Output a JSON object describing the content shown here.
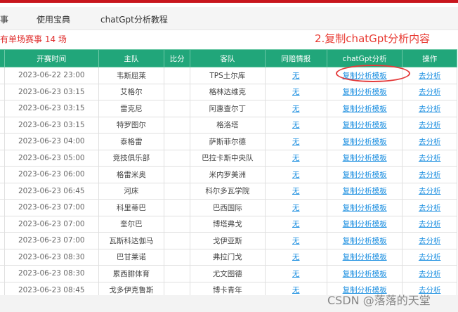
{
  "nav": {
    "items": [
      "事",
      "使用宝典",
      "chatGpt分析教程"
    ]
  },
  "summary": "有单场赛事 14 场",
  "annotation": "2.复制chatGpt分析内容",
  "table": {
    "headers": [
      "",
      "开赛时间",
      "主队",
      "比分",
      "客队",
      "同赔情报",
      "chatGpt分析",
      "操作"
    ],
    "rows": [
      [
        "2023-06-22 23:00",
        "韦斯屈莱",
        "",
        "TPS土尔库",
        "无",
        "复制分析模板",
        "去分析"
      ],
      [
        "2023-06-23 03:15",
        "艾格尔",
        "",
        "格林达维克",
        "无",
        "复制分析模板",
        "去分析"
      ],
      [
        "2023-06-23 03:15",
        "雷克尼",
        "",
        "阿惠查尔丁",
        "无",
        "复制分析模板",
        "去分析"
      ],
      [
        "2023-06-23 03:15",
        "特罗图尔",
        "",
        "格洛塔",
        "无",
        "复制分析模板",
        "去分析"
      ],
      [
        "2023-06-23 04:00",
        "泰格雷",
        "",
        "萨斯菲尔德",
        "无",
        "复制分析模板",
        "去分析"
      ],
      [
        "2023-06-23 05:00",
        "竞技俱乐部",
        "",
        "巴拉卡斯中央队",
        "无",
        "复制分析模板",
        "去分析"
      ],
      [
        "2023-06-23 06:00",
        "格雷米奥",
        "",
        "米内罗美洲",
        "无",
        "复制分析模板",
        "去分析"
      ],
      [
        "2023-06-23 06:45",
        "河床",
        "",
        "科尔多瓦学院",
        "无",
        "复制分析模板",
        "去分析"
      ],
      [
        "2023-06-23 07:00",
        "科里蒂巴",
        "",
        "巴西国际",
        "无",
        "复制分析模板",
        "去分析"
      ],
      [
        "2023-06-23 07:00",
        "奎尔巴",
        "",
        "博塔弗戈",
        "无",
        "复制分析模板",
        "去分析"
      ],
      [
        "2023-06-23 07:00",
        "瓦斯科达伽马",
        "",
        "戈伊亚斯",
        "无",
        "复制分析模板",
        "去分析"
      ],
      [
        "2023-06-23 08:30",
        "巴甘莱诺",
        "",
        "弗拉门戈",
        "无",
        "复制分析模板",
        "去分析"
      ],
      [
        "2023-06-23 08:30",
        "累西腓体育",
        "",
        "尤文图德",
        "无",
        "复制分析模板",
        "去分析"
      ],
      [
        "2023-06-23 08:45",
        "戈多伊克鲁斯",
        "",
        "博卡青年",
        "无",
        "复制分析模板",
        "去分析"
      ]
    ]
  },
  "watermark": "CSDN @落落的天堂"
}
